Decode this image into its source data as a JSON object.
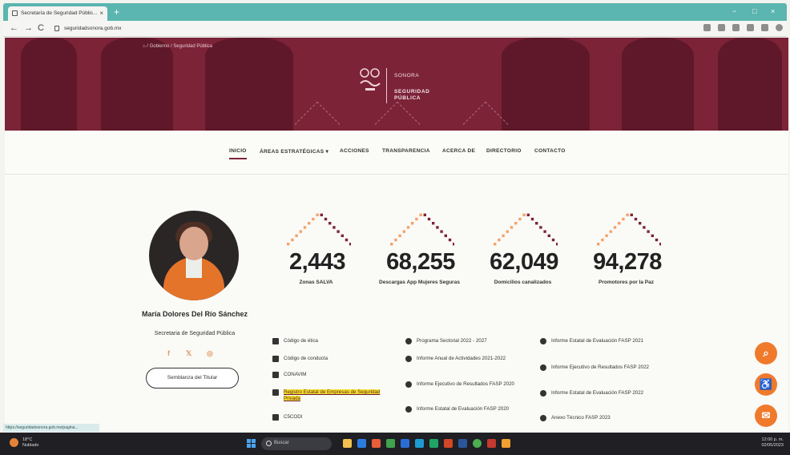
{
  "browser": {
    "tab_title": "Secretaría de Seguridad Públic...",
    "url": "seguridadsonora.gob.mx",
    "status_url": "https://seguridadsonora.gob.mx/pagina..."
  },
  "hero": {
    "breadcrumb": "⌂  /  Gobierno  /  Seguridad Pública",
    "logo_line1": "SONORA",
    "logo_line2": "SEGURIDAD PÚBLICA"
  },
  "menu": {
    "items": [
      "INICIO",
      "ÁREAS ESTRATÉGICAS ▾",
      "ACCIONES",
      "TRANSPARENCIA",
      "ACERCA DE",
      "DIRECTORIO",
      "CONTACTO"
    ]
  },
  "profile": {
    "name": "María Dolores Del Río Sánchez",
    "role": "Secretaria de Seguridad Pública",
    "social": [
      "f",
      "𝕏",
      "◎"
    ],
    "button": "Semblanza del Titular"
  },
  "stats": [
    {
      "value": "2,443",
      "label": "Zonas SALVA"
    },
    {
      "value": "68,255",
      "label": "Descargas App Mujeres Seguras"
    },
    {
      "value": "62,049",
      "label": "Domicilios canalizados"
    },
    {
      "value": "94,278",
      "label": "Promotores por la Paz"
    }
  ],
  "documents": {
    "col1": [
      "Código de ética",
      "Código de conducta",
      "CONAVIM",
      "Registro Estatal de Empresas de Seguridad Privada",
      "C5CODI"
    ],
    "col2": [
      "Programa Sectorial 2022 - 2027",
      "Informe Anual de Actividades 2021-2022",
      "Informe Ejecutivo de Resultados FASP 2020",
      "Informe Estatal de Evaluación FASP 2020"
    ],
    "col3": [
      "Informe Estatal de Evaluación FASP 2021",
      "Informe Ejecutivo de Resultados FASP 2022",
      "Informe Estatal de Evaluación FASP 2022",
      "Anexo Técnico FASP 2023"
    ]
  },
  "fab_icons": [
    "search-icon",
    "accessibility-icon",
    "feedback-icon"
  ],
  "taskbar": {
    "weather_temp": "18°C",
    "weather_desc": "Nublado",
    "search_label": "Buscar",
    "time": "12:00 p. m.",
    "date": "02/05/2023"
  },
  "colors": {
    "brand": "#7c2338",
    "accent": "#f07a2c",
    "dot_orange": "#f3a36a",
    "dot_maroon": "#7c2338"
  }
}
